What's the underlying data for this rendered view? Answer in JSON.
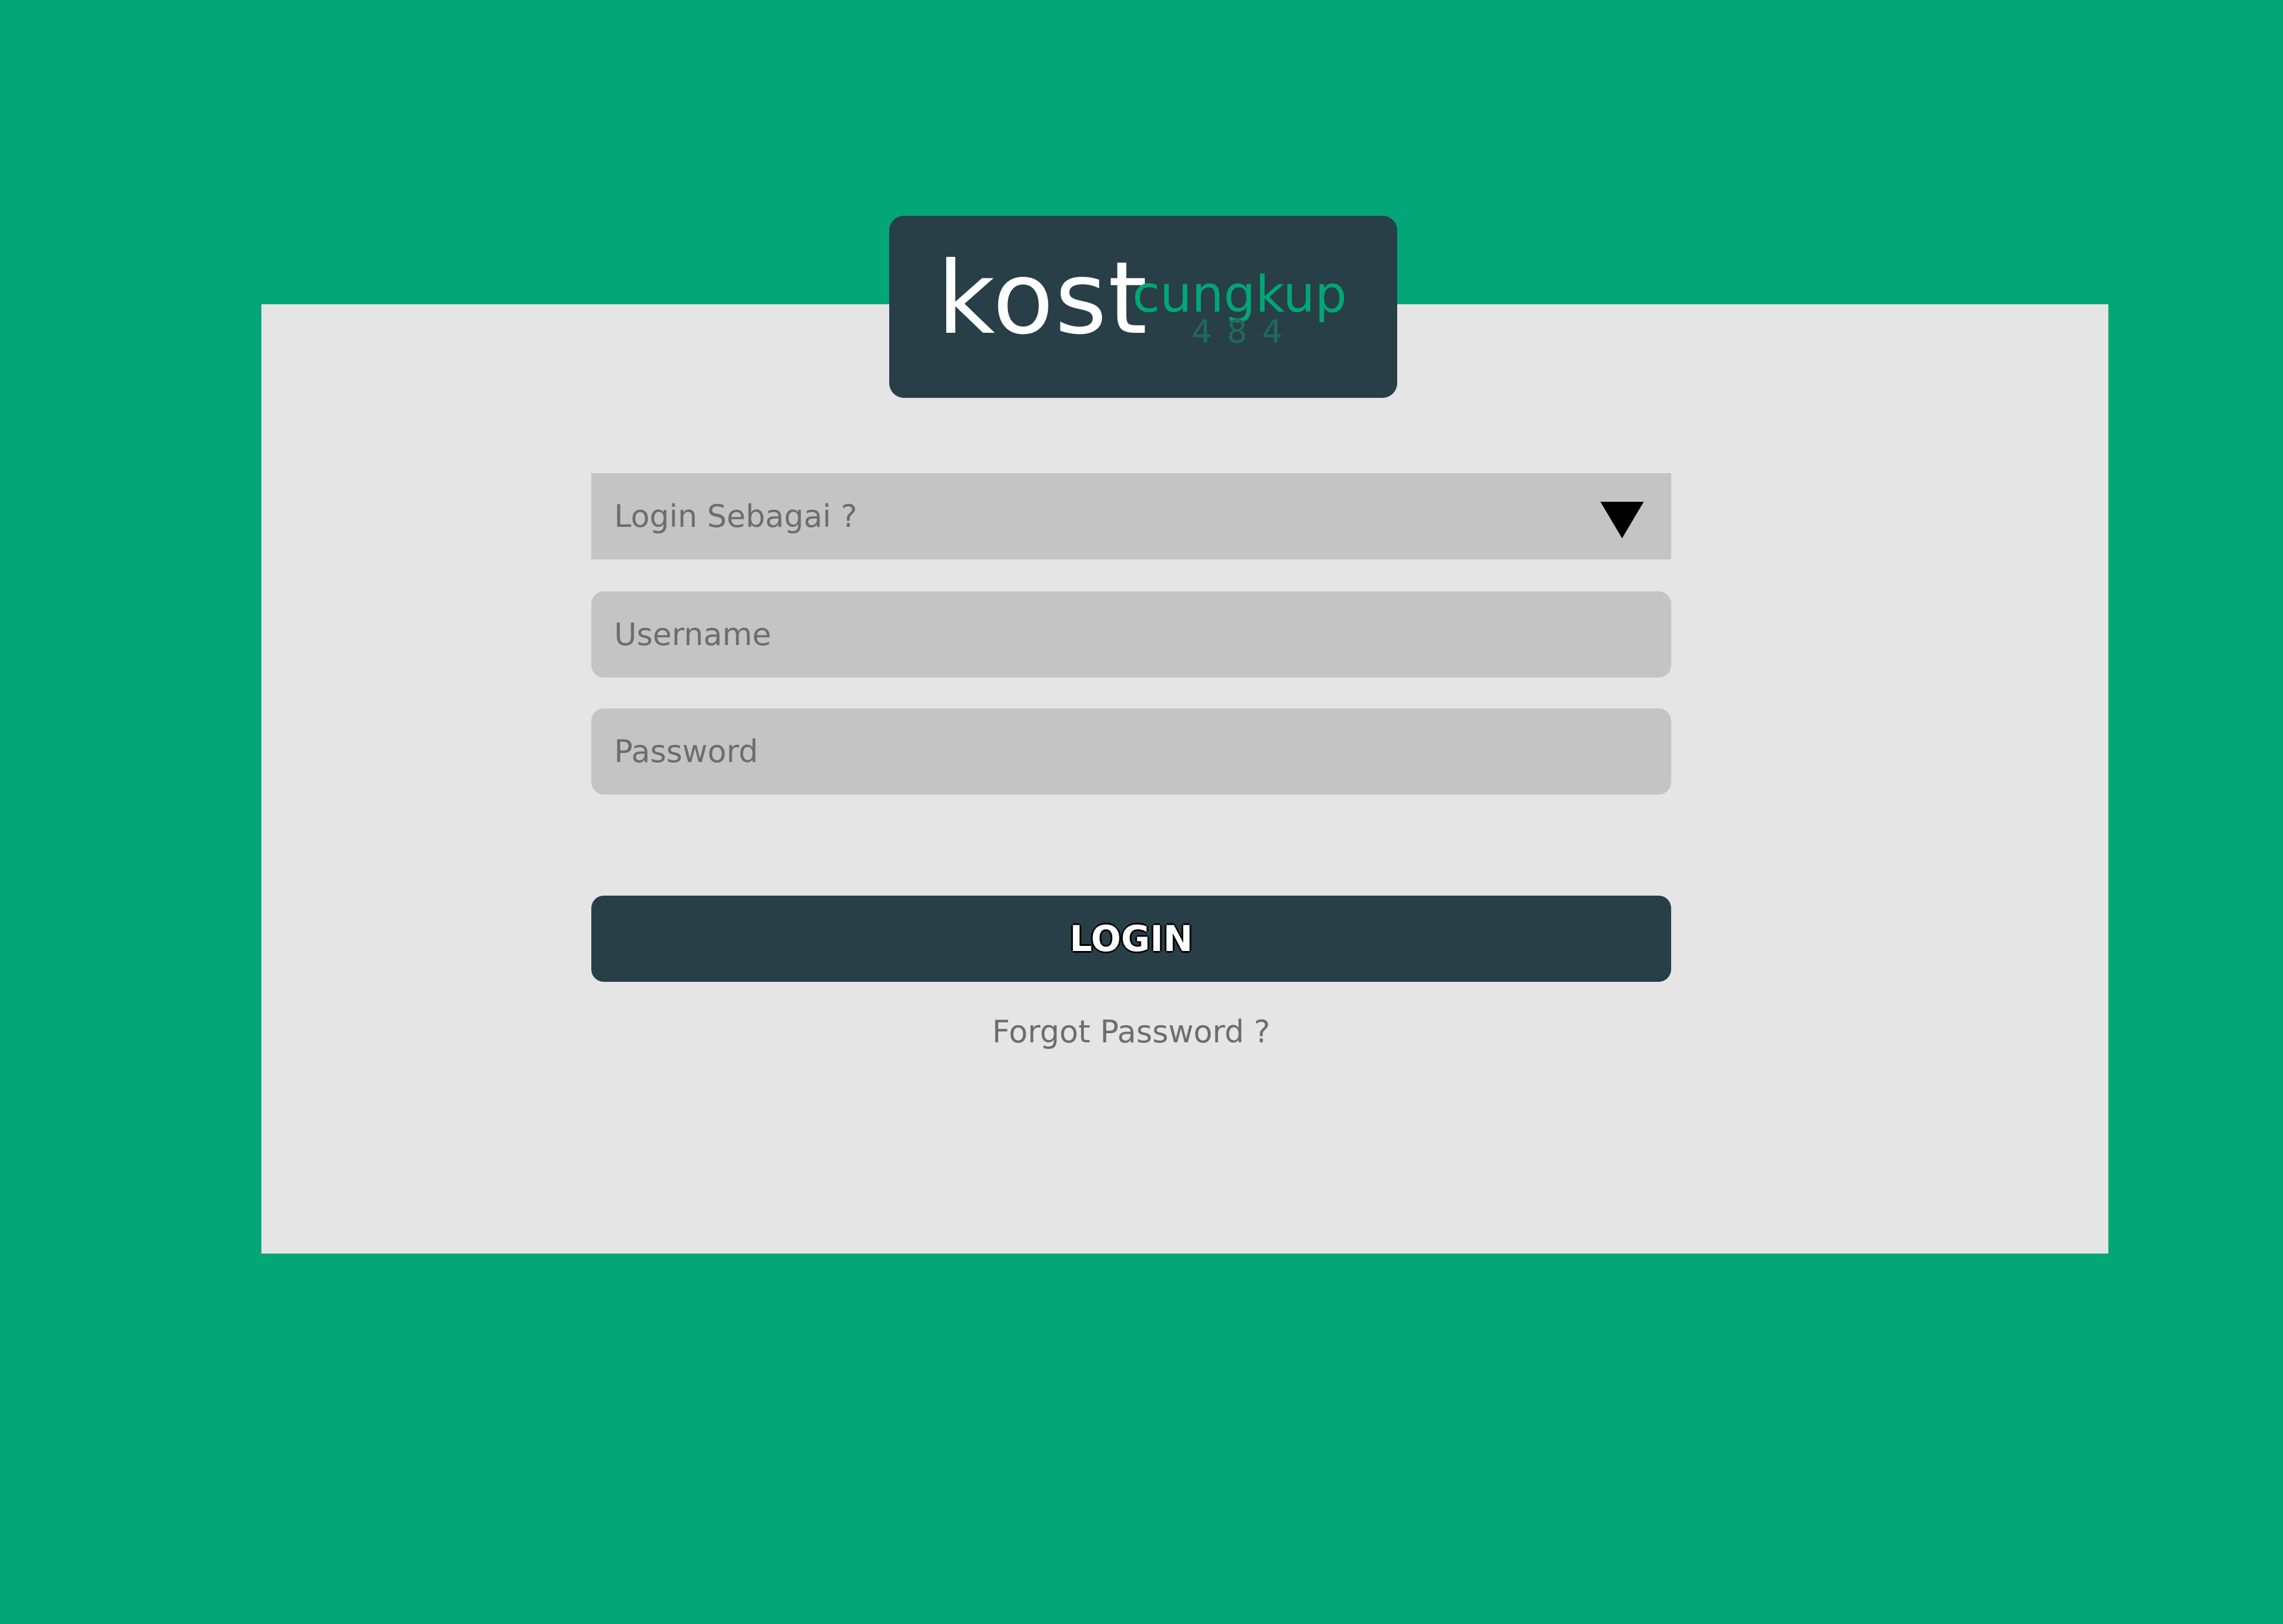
{
  "colors": {
    "page_background": "#02a677",
    "card_background": "#e5e5e5",
    "dark_panel": "#283f47",
    "field_background": "#c4c4c4",
    "accent_text": "#02a677",
    "muted_number": "#1f6a5c"
  },
  "logo": {
    "main": "kost",
    "sub": "cungkup",
    "number": "484"
  },
  "form": {
    "role_select": {
      "label": "Login Sebagai ?",
      "icon": "triangle-down-icon"
    },
    "username_placeholder": "Username",
    "password_placeholder": "Password",
    "login_label": "LOGIN",
    "forgot_label": "Forgot Password ?"
  }
}
